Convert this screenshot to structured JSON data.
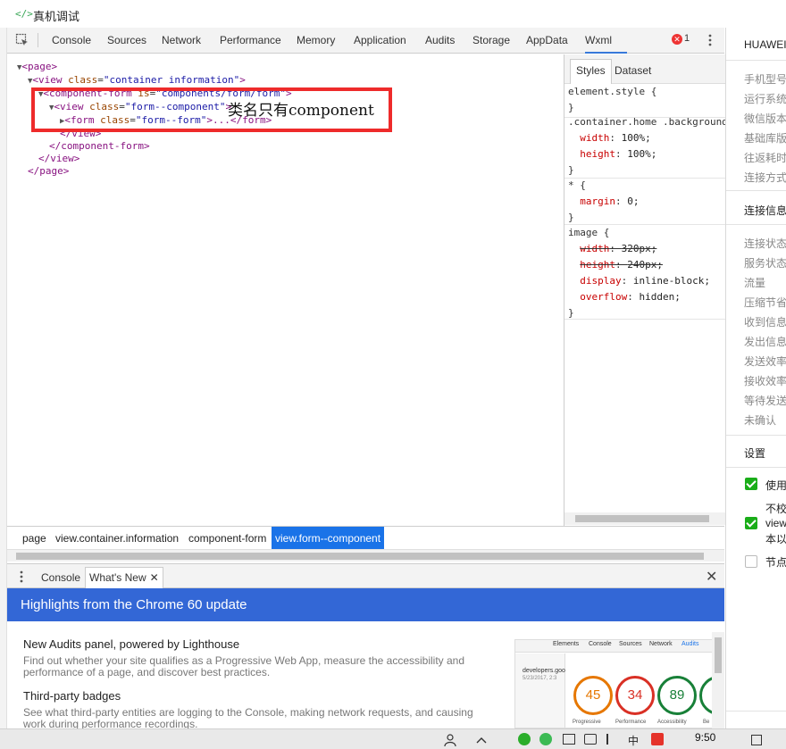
{
  "window": {
    "title": "真机调试",
    "icon": "code-brackets-icon"
  },
  "devtools_tabs": [
    "Console",
    "Sources",
    "Network",
    "Performance",
    "Memory",
    "Application",
    "Audits",
    "Storage",
    "AppData",
    "Wxml"
  ],
  "active_tab": "Wxml",
  "error_count": "1",
  "tree": {
    "line1": {
      "tag": "<page>"
    },
    "line2": {
      "open": "<view",
      "attr": "class",
      "val": "\"container information\"",
      "close": ">"
    },
    "line3": {
      "open": "<component-form",
      "attr": "is",
      "val": "\"components/form/form\"",
      "close": ">"
    },
    "line4": {
      "open": "<view",
      "attr": "class",
      "val": "\"form--component\"",
      "close": ">"
    },
    "line5": {
      "open": "<form",
      "attr": "class",
      "val": "\"form--form\"",
      "mid": ">...",
      "close": "</form>"
    },
    "line6": {
      "tag": "</view>"
    },
    "line7": {
      "tag": "</component-form>"
    },
    "line8": {
      "tag": "</view>"
    },
    "line9": {
      "tag": "</page>"
    }
  },
  "annotation": "类名只有component",
  "styles_pane": {
    "tabs": [
      "Styles",
      "Dataset"
    ],
    "rules": [
      {
        "selector": "element.style {",
        "close": "}"
      },
      {
        "selector": ".container.home .background",
        "props": [
          {
            "name": "width",
            "value": "100%;"
          },
          {
            "name": "height",
            "value": "100%;"
          }
        ],
        "close": "}"
      },
      {
        "selector": "* {",
        "props": [
          {
            "name": "margin",
            "value": "0;"
          }
        ],
        "close": "}"
      },
      {
        "selector": "image {",
        "props": [
          {
            "name": "width",
            "value": "320px;"
          },
          {
            "name": "height",
            "value": "240px;"
          },
          {
            "name": "display",
            "value": "inline-block;"
          },
          {
            "name": "overflow",
            "value": "hidden;"
          }
        ],
        "close": "}"
      }
    ]
  },
  "breadcrumb": [
    "page",
    "view.container.information",
    "component-form",
    "view.form--component"
  ],
  "drawer": {
    "tabs": [
      "Console",
      "What's New"
    ],
    "banner": "Highlights from the Chrome 60 update",
    "items": [
      {
        "heading": "New Audits panel, powered by Lighthouse",
        "body": "Find out whether your site qualifies as a Progressive Web App, measure the accessibility and performance of a page, and discover best practices."
      },
      {
        "heading": "Third-party badges",
        "body": "See what third-party entities are logging to the Console, making network requests, and causing work during performance recordings."
      }
    ],
    "preview": {
      "tabs": [
        "Elements",
        "Console",
        "Sources",
        "Network",
        "Audits"
      ],
      "url": "developers.goo",
      "date": "5/23/2017, 2:3",
      "scores": [
        {
          "value": "45",
          "label": "Progressive",
          "color": "#e67700"
        },
        {
          "value": "34",
          "label": "Performance",
          "color": "#d93025"
        },
        {
          "value": "89",
          "label": "Accessibility",
          "color": "#188038"
        },
        {
          "value": "",
          "label": "Be",
          "color": "#188038"
        }
      ]
    }
  },
  "right_panel": {
    "device": "HUAWEI",
    "info": [
      "手机型号",
      "运行系统",
      "微信版本",
      "基础库版",
      "往返耗时",
      "连接方式"
    ],
    "conn_title": "连接信息",
    "conn": [
      "连接状态",
      "服务状态",
      "流量",
      "压缩节省",
      "收到信息",
      "发出信息",
      "发送效率",
      "接收效率",
      "等待发送",
      "未确认"
    ],
    "settings_title": "设置",
    "settings": [
      {
        "label": "使用",
        "checked": true
      },
      {
        "label_lines": [
          "不校",
          "view",
          "本以"
        ],
        "checked": true
      },
      {
        "label": "节点",
        "checked": false
      }
    ]
  },
  "taskbar": {
    "ime": "中",
    "time": "9:50"
  }
}
